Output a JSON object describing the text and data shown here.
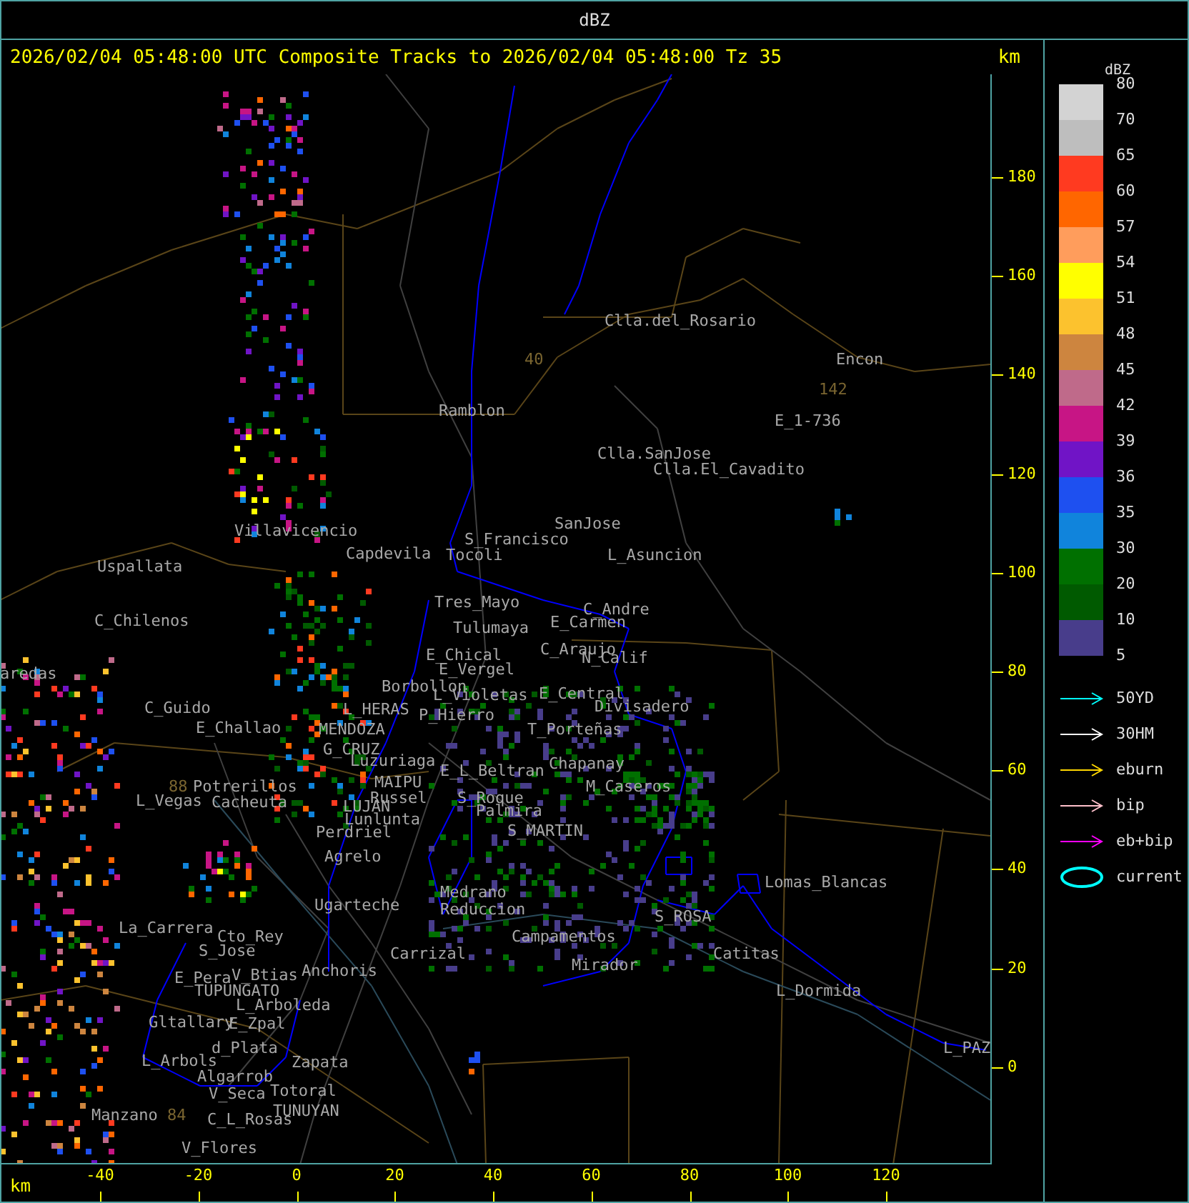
{
  "window": {
    "title": "dBZ"
  },
  "header": {
    "caption": "2026/02/04 05:48:00 UTC Composite Tracks to 2026/02/04 05:48:00 Tz 35",
    "y_unit": "km"
  },
  "x_axis": {
    "unit": "km",
    "ticks": [
      "-40",
      "-20",
      "0",
      "20",
      "40",
      "60",
      "80",
      "100",
      "120"
    ]
  },
  "y_axis": {
    "ticks": [
      "180",
      "160",
      "140",
      "120",
      "100",
      "80",
      "60",
      "40",
      "20",
      "0"
    ]
  },
  "places": [
    {
      "name": "Clla.del_Rosario",
      "kind": "town"
    },
    {
      "name": "40",
      "kind": "route"
    },
    {
      "name": "Encon",
      "kind": "town"
    },
    {
      "name": "142",
      "kind": "route"
    },
    {
      "name": "Ramblon",
      "kind": "town"
    },
    {
      "name": "E_1-736",
      "kind": "town"
    },
    {
      "name": "Clla.SanJose",
      "kind": "town"
    },
    {
      "name": "Clla.El_Cavadito",
      "kind": "town"
    },
    {
      "name": "Villavicencio",
      "kind": "town"
    },
    {
      "name": "SanJose",
      "kind": "town"
    },
    {
      "name": "S_Francisco",
      "kind": "town"
    },
    {
      "name": "Capdevila",
      "kind": "town"
    },
    {
      "name": "Tocoli",
      "kind": "town"
    },
    {
      "name": "L_Asuncion",
      "kind": "town"
    },
    {
      "name": "Uspallata",
      "kind": "town"
    },
    {
      "name": "Tres_Mayo",
      "kind": "town"
    },
    {
      "name": "C_Andre",
      "kind": "town"
    },
    {
      "name": "C_Chilenos",
      "kind": "town"
    },
    {
      "name": "Tulumaya",
      "kind": "town"
    },
    {
      "name": "E_Carmen",
      "kind": "town"
    },
    {
      "name": "E_Chical",
      "kind": "town"
    },
    {
      "name": "C_Araujo",
      "kind": "town"
    },
    {
      "name": "N_Calif",
      "kind": "town"
    },
    {
      "name": "aredas",
      "kind": "town"
    },
    {
      "name": "E_Vergel",
      "kind": "town"
    },
    {
      "name": "Borbollon",
      "kind": "town"
    },
    {
      "name": "L_Violetas",
      "kind": "town"
    },
    {
      "name": "E_Central",
      "kind": "town"
    },
    {
      "name": "C_Guido",
      "kind": "town"
    },
    {
      "name": "L_HERAS",
      "kind": "town"
    },
    {
      "name": "P_Hierro",
      "kind": "town"
    },
    {
      "name": "Divisadero",
      "kind": "town"
    },
    {
      "name": "E_Challao",
      "kind": "town"
    },
    {
      "name": "MENDOZA",
      "kind": "town"
    },
    {
      "name": "T_Porteñas",
      "kind": "town"
    },
    {
      "name": "G_CRUZ",
      "kind": "town"
    },
    {
      "name": "Luzuriaga",
      "kind": "town"
    },
    {
      "name": "E_L_Beltran",
      "kind": "town"
    },
    {
      "name": "Chapanay",
      "kind": "town"
    },
    {
      "name": "88",
      "kind": "route"
    },
    {
      "name": "Potrerillos",
      "kind": "town"
    },
    {
      "name": "MAIPU",
      "kind": "town"
    },
    {
      "name": "M_Caseros",
      "kind": "town"
    },
    {
      "name": "L_Vegas",
      "kind": "town"
    },
    {
      "name": "Cacheuta",
      "kind": "town"
    },
    {
      "name": "LUJAN",
      "kind": "town"
    },
    {
      "name": "Russel",
      "kind": "town"
    },
    {
      "name": "S_Roque",
      "kind": "town"
    },
    {
      "name": "Lunlunta",
      "kind": "town"
    },
    {
      "name": "Palmira",
      "kind": "town"
    },
    {
      "name": "Perdriel",
      "kind": "town"
    },
    {
      "name": "S_MARTIN",
      "kind": "town"
    },
    {
      "name": "Agrelo",
      "kind": "town"
    },
    {
      "name": "Lomas_Blancas",
      "kind": "town"
    },
    {
      "name": "Medrano",
      "kind": "town"
    },
    {
      "name": "Ugarteche",
      "kind": "town"
    },
    {
      "name": "Reduccion",
      "kind": "town"
    },
    {
      "name": "S_ROSA",
      "kind": "town"
    },
    {
      "name": "La_Carrera",
      "kind": "town"
    },
    {
      "name": "Cto_Rey",
      "kind": "town"
    },
    {
      "name": "Campamentos",
      "kind": "town"
    },
    {
      "name": "S_Jose",
      "kind": "town"
    },
    {
      "name": "Carrizal",
      "kind": "town"
    },
    {
      "name": "Catitas",
      "kind": "town"
    },
    {
      "name": "E_Pera",
      "kind": "town"
    },
    {
      "name": "V_Btias",
      "kind": "town"
    },
    {
      "name": "Anchoris",
      "kind": "town"
    },
    {
      "name": "Mirador",
      "kind": "town"
    },
    {
      "name": "TUPUNGATO",
      "kind": "town"
    },
    {
      "name": "L_Dormida",
      "kind": "town"
    },
    {
      "name": "L_Arboleda",
      "kind": "town"
    },
    {
      "name": "Gltallary",
      "kind": "town"
    },
    {
      "name": "E_Zpal",
      "kind": "town"
    },
    {
      "name": "d_Plata",
      "kind": "town"
    },
    {
      "name": "L_PAZ",
      "kind": "town"
    },
    {
      "name": "L_Arbols",
      "kind": "town"
    },
    {
      "name": "Zapata",
      "kind": "town"
    },
    {
      "name": "Algarrob",
      "kind": "town"
    },
    {
      "name": "V_Seca",
      "kind": "town"
    },
    {
      "name": "Totoral",
      "kind": "town"
    },
    {
      "name": "Manzano",
      "kind": "town"
    },
    {
      "name": "84",
      "kind": "route"
    },
    {
      "name": "C_L_Rosas",
      "kind": "town"
    },
    {
      "name": "TUNUYAN",
      "kind": "town"
    },
    {
      "name": "V_Flores",
      "kind": "town"
    }
  ],
  "legend": {
    "title": "dBZ",
    "scale": [
      {
        "label": "80",
        "color": "#d3d3d3"
      },
      {
        "label": "70",
        "color": "#bebebe"
      },
      {
        "label": "65",
        "color": "#ff3a20"
      },
      {
        "label": "60",
        "color": "#ff6600"
      },
      {
        "label": "57",
        "color": "#ff9d5c"
      },
      {
        "label": "54",
        "color": "#ffff00"
      },
      {
        "label": "51",
        "color": "#fcc22e"
      },
      {
        "label": "48",
        "color": "#cd853f"
      },
      {
        "label": "45",
        "color": "#bf6a8a"
      },
      {
        "label": "42",
        "color": "#c71585"
      },
      {
        "label": "39",
        "color": "#7014c6"
      },
      {
        "label": "36",
        "color": "#1e50f0"
      },
      {
        "label": "35",
        "color": "#1084dc"
      },
      {
        "label": "30",
        "color": "#007000"
      },
      {
        "label": "20",
        "color": "#005a00"
      },
      {
        "label": "10",
        "color": "#483d8b"
      },
      {
        "label": "5"
      }
    ],
    "tracks": [
      {
        "label": "50YD",
        "color": "#00ffff",
        "kind": "arrow"
      },
      {
        "label": "30HM",
        "color": "#ffffff",
        "kind": "arrow"
      },
      {
        "label": "eburn",
        "color": "#ffd700",
        "kind": "arrow"
      },
      {
        "label": "bip",
        "color": "#ffc0cb",
        "kind": "arrow"
      },
      {
        "label": "eb+bip",
        "color": "#ff00ff",
        "kind": "arrow"
      },
      {
        "label": "current",
        "color": "#00ffff",
        "kind": "ellipse"
      }
    ]
  }
}
